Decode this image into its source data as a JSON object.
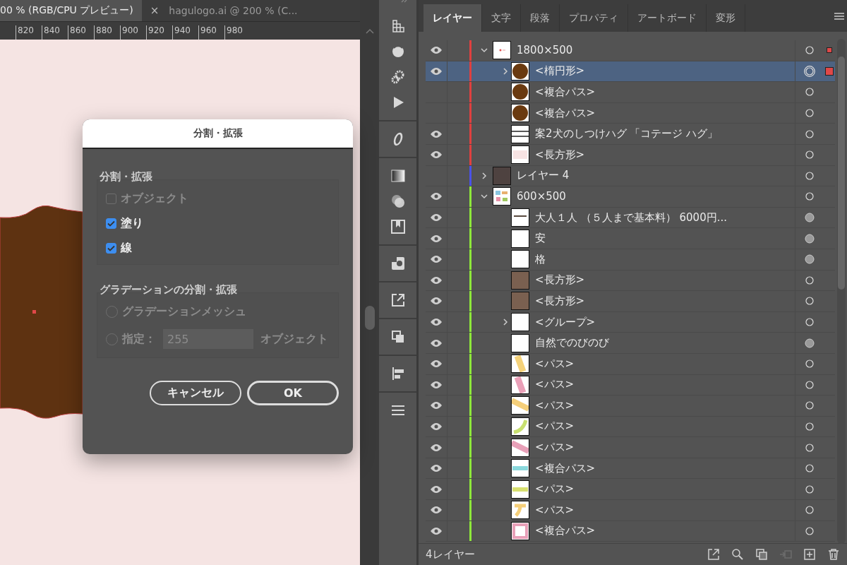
{
  "document_tabs": [
    {
      "label": "00 % (RGB/CPU プレビュー)",
      "selected": true
    },
    {
      "label": "hagulogo.ai @ 200 % (C...",
      "selected": false,
      "close": "×"
    }
  ],
  "ruler": [
    "820",
    "840",
    "860",
    "880",
    "900",
    "920",
    "940",
    "960",
    "980"
  ],
  "dialog": {
    "title": "分割・拡張",
    "groups": [
      {
        "legend": "分割・拡張",
        "options": [
          {
            "kind": "checkbox",
            "label": "オブジェクト",
            "checked": false,
            "disabled": true
          },
          {
            "kind": "checkbox",
            "label": "塗り",
            "checked": true,
            "disabled": false
          },
          {
            "kind": "checkbox",
            "label": "線",
            "checked": true,
            "disabled": false
          }
        ]
      },
      {
        "legend": "グラデーションの分割・拡張",
        "options": [
          {
            "kind": "radio",
            "label": "グラデーションメッシュ",
            "selected": false,
            "disabled": true
          },
          {
            "kind": "radio-field",
            "label": "指定：",
            "selected": false,
            "disabled": true,
            "value": "255",
            "suffix": "オブジェクト"
          }
        ]
      }
    ],
    "buttons": [
      {
        "label": "キャンセル",
        "default": false
      },
      {
        "label": "OK",
        "default": true
      }
    ]
  },
  "panel": {
    "tabs": [
      {
        "label": "レイヤー",
        "selected": true
      },
      {
        "label": "文字",
        "selected": false
      },
      {
        "label": "段落",
        "selected": false
      },
      {
        "label": "プロパティ",
        "selected": false
      },
      {
        "label": "アートボード",
        "selected": false
      },
      {
        "label": "変形",
        "selected": false
      }
    ],
    "layers": [
      {
        "name": "1800×500",
        "color": "#e0403f",
        "visible": true,
        "expanded": true,
        "thumbnail": {
          "kind": "artboard"
        },
        "appearance": false,
        "selected": false,
        "selected_art": true,
        "partial": true,
        "children": [
          {
            "name": "<楕円形>",
            "visible": true,
            "expanded": false,
            "thumbnail": {
              "kind": "circle"
            },
            "appearance": false,
            "selected": true,
            "selected_art": true,
            "partial": false
          },
          {
            "name": "<複合パス>",
            "visible": false,
            "thumbnail": {
              "kind": "circle"
            },
            "appearance": false,
            "selected": false,
            "selected_art": false
          },
          {
            "name": "<複合パス>",
            "visible": false,
            "thumbnail": {
              "kind": "circle"
            },
            "appearance": false,
            "selected": false,
            "selected_art": false
          },
          {
            "name": "案2犬のしつけハグ 「コテージ ハグ」",
            "visible": true,
            "thumbnail": {
              "kind": "lines"
            },
            "appearance": false,
            "selected": false,
            "selected_art": false
          },
          {
            "name": "<長方形>",
            "visible": true,
            "thumbnail": {
              "kind": "pale"
            },
            "appearance": false,
            "selected": false,
            "selected_art": false
          }
        ]
      },
      {
        "name": "レイヤー 4",
        "color": "#4a52e8",
        "visible": false,
        "expanded": false,
        "thumbnail": {
          "kind": "dark"
        },
        "appearance": false,
        "selected": false,
        "selected_art": false
      },
      {
        "name": "600×500",
        "color": "#8ee83a",
        "visible": true,
        "expanded": true,
        "thumbnail": {
          "kind": "collage"
        },
        "appearance": false,
        "selected": false,
        "selected_art": false,
        "children": [
          {
            "name": "大人１人 （５人まで基本料） 6000円...",
            "visible": true,
            "thumbnail": {
              "kind": "text"
            },
            "appearance": true,
            "selected": false,
            "selected_art": false
          },
          {
            "name": "安",
            "visible": true,
            "thumbnail": {
              "kind": "blank"
            },
            "appearance": true,
            "selected": false,
            "selected_art": false
          },
          {
            "name": "格",
            "visible": true,
            "thumbnail": {
              "kind": "blank"
            },
            "appearance": true,
            "selected": false,
            "selected_art": false
          },
          {
            "name": "<長方形>",
            "visible": true,
            "thumbnail": {
              "kind": "swatch"
            },
            "appearance": false,
            "selected": false,
            "selected_art": false
          },
          {
            "name": "<長方形>",
            "visible": true,
            "thumbnail": {
              "kind": "swatch"
            },
            "appearance": false,
            "selected": false,
            "selected_art": false
          },
          {
            "name": "<グループ>",
            "visible": true,
            "expanded": false,
            "thumbnail": {
              "kind": "blank"
            },
            "appearance": false,
            "selected": false,
            "selected_art": false
          },
          {
            "name": "自然でのびのび",
            "visible": true,
            "thumbnail": {
              "kind": "blank"
            },
            "appearance": true,
            "selected": false,
            "selected_art": false
          },
          {
            "name": "<パス>",
            "visible": true,
            "thumbnail": {
              "kind": "bar",
              "color": "#f5d27a"
            },
            "appearance": false,
            "selected": false,
            "selected_art": false
          },
          {
            "name": "<パス>",
            "visible": true,
            "thumbnail": {
              "kind": "bar",
              "color": "#eaa0b8"
            },
            "appearance": false,
            "selected": false,
            "selected_art": false
          },
          {
            "name": "<パス>",
            "visible": true,
            "thumbnail": {
              "kind": "diag",
              "color": "#f5cf7a"
            },
            "appearance": false,
            "selected": false,
            "selected_art": false
          },
          {
            "name": "<パス>",
            "visible": true,
            "thumbnail": {
              "kind": "curve",
              "color": "#c8e070"
            },
            "appearance": false,
            "selected": false,
            "selected_art": false
          },
          {
            "name": "<パス>",
            "visible": true,
            "thumbnail": {
              "kind": "diag",
              "color": "#e8a0b8"
            },
            "appearance": false,
            "selected": false,
            "selected_art": false
          },
          {
            "name": "<複合パス>",
            "visible": true,
            "thumbnail": {
              "kind": "hline",
              "color": "#8ad8dc"
            },
            "appearance": false,
            "selected": false,
            "selected_art": false
          },
          {
            "name": "<パス>",
            "visible": true,
            "thumbnail": {
              "kind": "hline",
              "color": "#d8e070"
            },
            "appearance": false,
            "selected": false,
            "selected_art": false
          },
          {
            "name": "<パス>",
            "visible": true,
            "thumbnail": {
              "kind": "te",
              "color": "#f5cf7a"
            },
            "appearance": false,
            "selected": false,
            "selected_art": false
          },
          {
            "name": "<複合パス>",
            "visible": true,
            "thumbnail": {
              "kind": "frame",
              "color": "#e8a0b8"
            },
            "appearance": false,
            "selected": false,
            "selected_art": false
          }
        ]
      }
    ],
    "footer": {
      "count": "4レイヤー"
    }
  }
}
